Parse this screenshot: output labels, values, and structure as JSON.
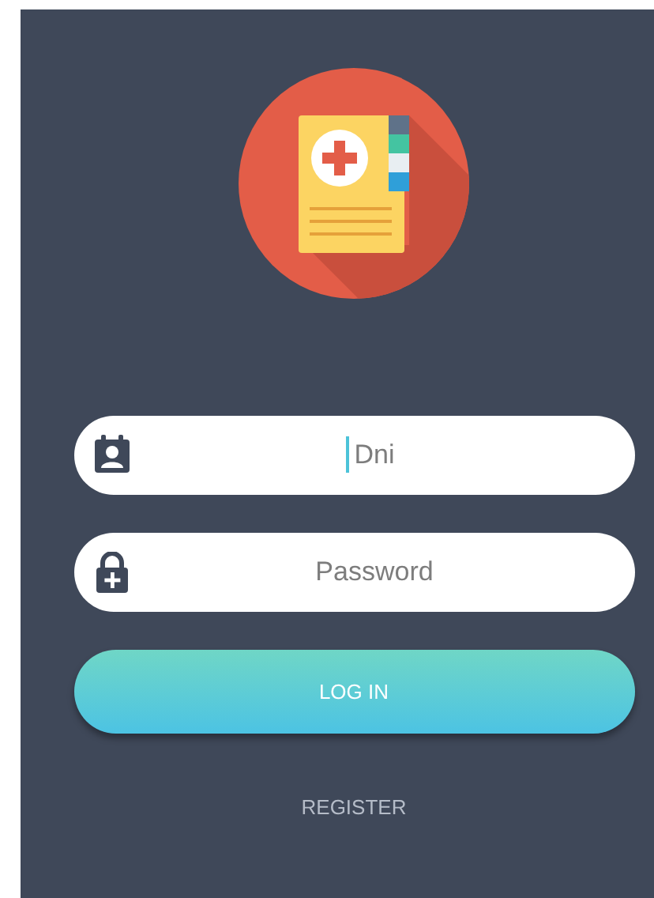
{
  "fields": [
    {
      "kind": "id",
      "placeholder": "Dni",
      "focused": true
    },
    {
      "kind": "password",
      "placeholder": "Password",
      "focused": false
    }
  ],
  "login_button": "LOG IN",
  "register_link": "REGISTER"
}
